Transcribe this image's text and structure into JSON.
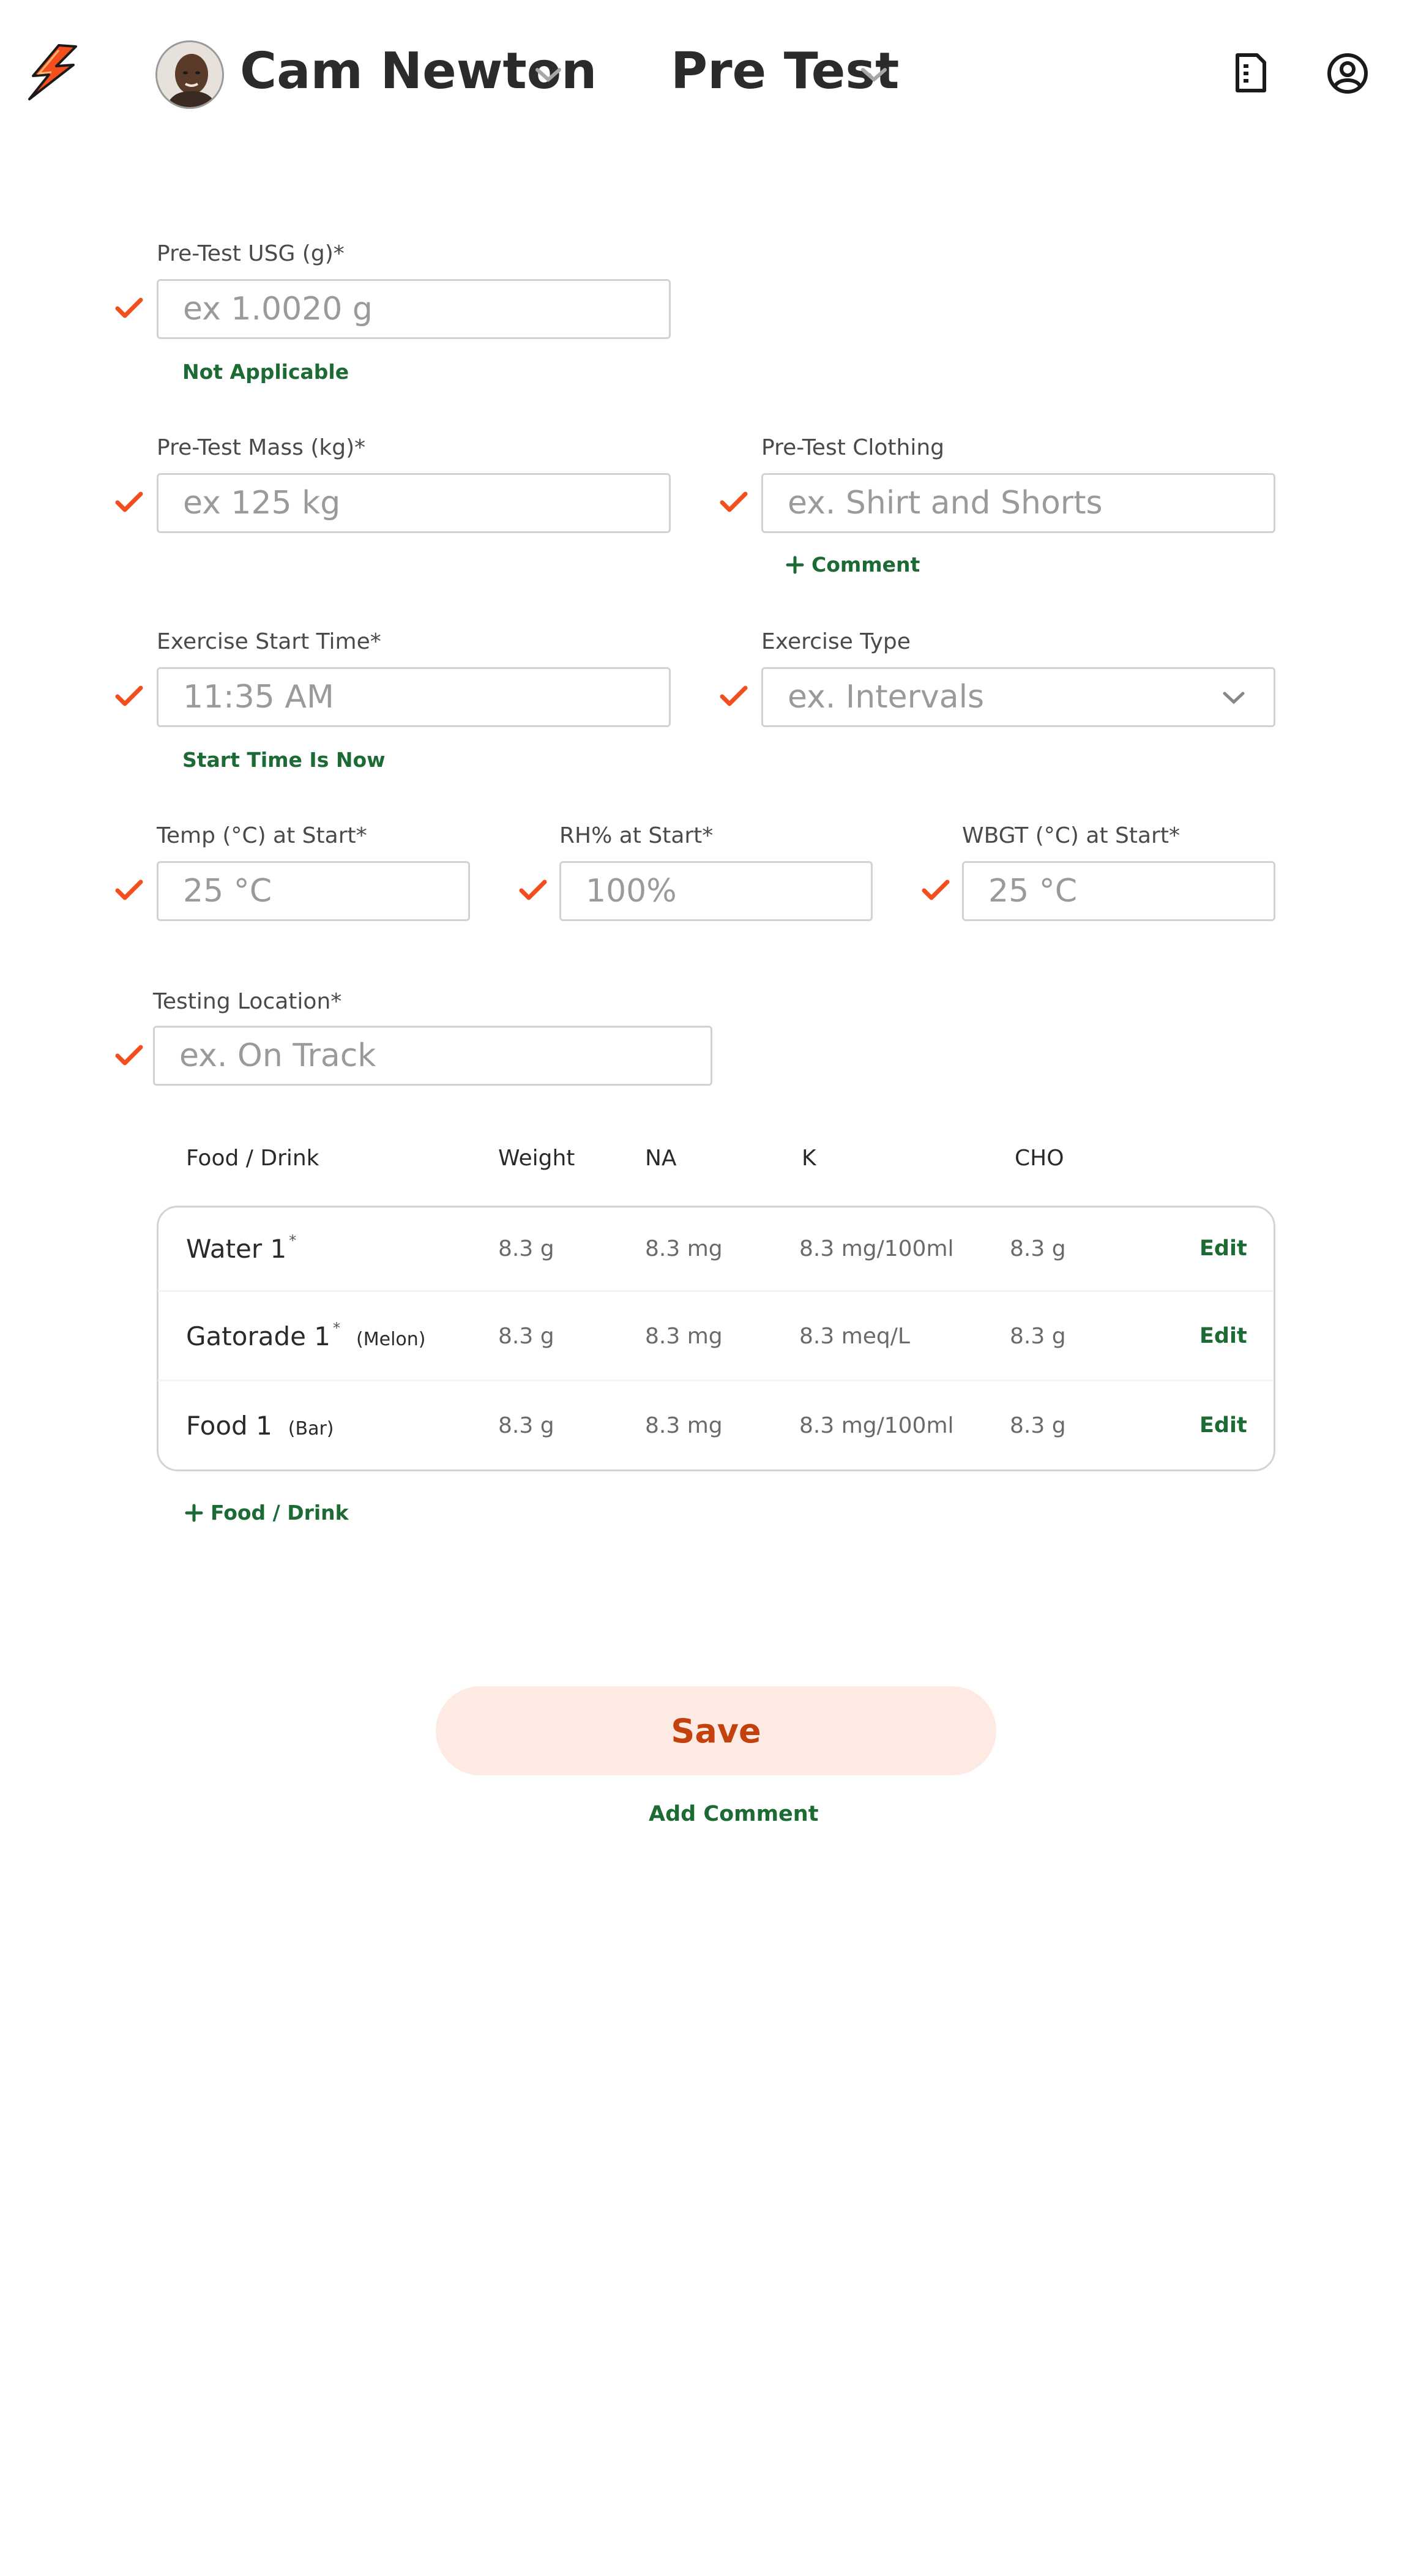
{
  "header": {
    "athlete_name": "Cam Newton",
    "test_type": "Pre Test"
  },
  "form": {
    "usg": {
      "label": "Pre-Test USG (g)*",
      "placeholder": "ex 1.0020 g",
      "link": "Not Applicable"
    },
    "mass": {
      "label": "Pre-Test Mass (kg)*",
      "placeholder": "ex 125 kg"
    },
    "clothing": {
      "label": "Pre-Test Clothing",
      "placeholder": "ex. Shirt and Shorts",
      "link": "Comment"
    },
    "start_time": {
      "label": "Exercise Start Time*",
      "placeholder": "11:35 AM",
      "link": "Start Time Is Now"
    },
    "exercise_type": {
      "label": "Exercise Type",
      "placeholder": "ex. Intervals"
    },
    "temp": {
      "label": "Temp (°C) at Start*",
      "placeholder": "25 °C"
    },
    "rh": {
      "label": "RH% at Start*",
      "placeholder": "100%"
    },
    "wbgt": {
      "label": "WBGT (°C) at Start*",
      "placeholder": "25 °C"
    },
    "location": {
      "label": "Testing Location*",
      "placeholder": "ex. On Track"
    }
  },
  "table": {
    "headers": [
      "Food / Drink",
      "Weight",
      "NA",
      "K",
      "CHO"
    ],
    "rows": [
      {
        "name": "Water 1",
        "sup": "*",
        "sub": "",
        "weight": "8.3 g",
        "na": "8.3 mg",
        "k": "8.3 mg/100ml",
        "cho": "8.3 g",
        "action": "Edit"
      },
      {
        "name": "Gatorade 1",
        "sup": "*",
        "sub": "(Melon)",
        "weight": "8.3 g",
        "na": "8.3 mg",
        "k": "8.3 meq/L",
        "cho": "8.3 g",
        "action": "Edit"
      },
      {
        "name": "Food 1",
        "sup": "",
        "sub": "(Bar)",
        "weight": "8.3 g",
        "na": "8.3 mg",
        "k": "8.3 mg/100ml",
        "cho": "8.3 g",
        "action": "Edit"
      }
    ],
    "add_link": "Food / Drink"
  },
  "actions": {
    "save": "Save",
    "add_comment": "Add Comment"
  },
  "colors": {
    "accent_orange": "#f24e1e",
    "green": "#1c6b34",
    "save_bg": "#fdebe3",
    "save_text": "#c2410c"
  },
  "icons": [
    "gatorade-bolt-logo",
    "chevron-down-icon",
    "sd-card-icon",
    "user-circle-icon",
    "checkmark-icon",
    "plus-icon"
  ]
}
